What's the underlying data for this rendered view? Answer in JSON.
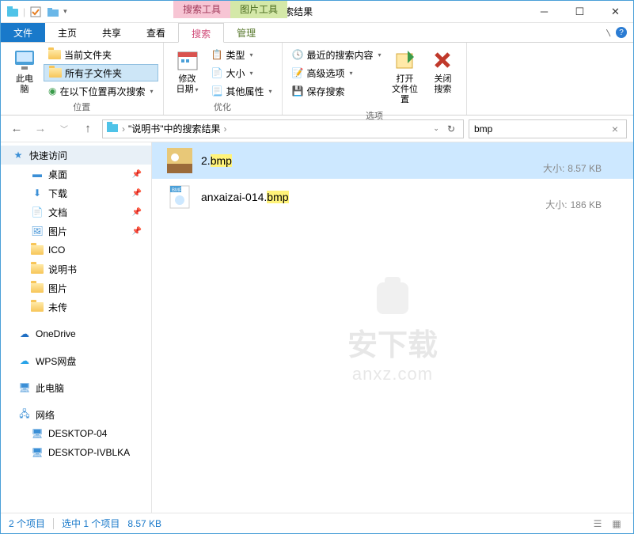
{
  "title": "bmp - \"说明书\"中的搜索结果",
  "context_tabs": {
    "search": "搜索工具",
    "picture": "图片工具"
  },
  "tabs": {
    "file": "文件",
    "home": "主页",
    "share": "共享",
    "view": "查看",
    "search": "搜索",
    "manage": "管理"
  },
  "ribbon": {
    "this_pc": "此电\n脑",
    "current_folder": "当前文件夹",
    "all_subfolders": "所有子文件夹",
    "search_again_in": "在以下位置再次搜索",
    "group_location": "位置",
    "modify_date": "修改\n日期",
    "type": "类型",
    "size": "大小",
    "other_props": "其他属性",
    "group_refine": "优化",
    "recent_searches": "最近的搜索内容",
    "advanced_options": "高级选项",
    "save_search": "保存搜索",
    "open_location": "打开\n文件位置",
    "close_search": "关闭\n搜索",
    "group_options": "选项"
  },
  "address": {
    "path": "\"说明书\"中的搜索结果",
    "sep": "›"
  },
  "search_value": "bmp",
  "sidebar": {
    "quick_access": "快速访问",
    "desktop": "桌面",
    "downloads": "下载",
    "documents": "文档",
    "pictures": "图片",
    "ico": "ICO",
    "manual": "说明书",
    "pictures2": "图片",
    "untransferred": "未传",
    "onedrive": "OneDrive",
    "wps": "WPS网盘",
    "this_pc": "此电脑",
    "network": "网络",
    "desktop04": "DESKTOP-04",
    "desktopiv": "DESKTOP-IVBLKA"
  },
  "files": [
    {
      "name_pre": "2.",
      "name_hl": "bmp",
      "name_post": "",
      "size_label": "大小:",
      "size": "8.57 KB",
      "selected": true
    },
    {
      "name_pre": "anxaizai-014.",
      "name_hl": "bmp",
      "name_post": "",
      "size_label": "大小:",
      "size": "186 KB",
      "selected": false
    }
  ],
  "watermark": {
    "line1": "安下载",
    "line2": "anxz.com"
  },
  "status": {
    "count": "2 个项目",
    "selected": "选中 1 个项目",
    "size": "8.57 KB"
  }
}
